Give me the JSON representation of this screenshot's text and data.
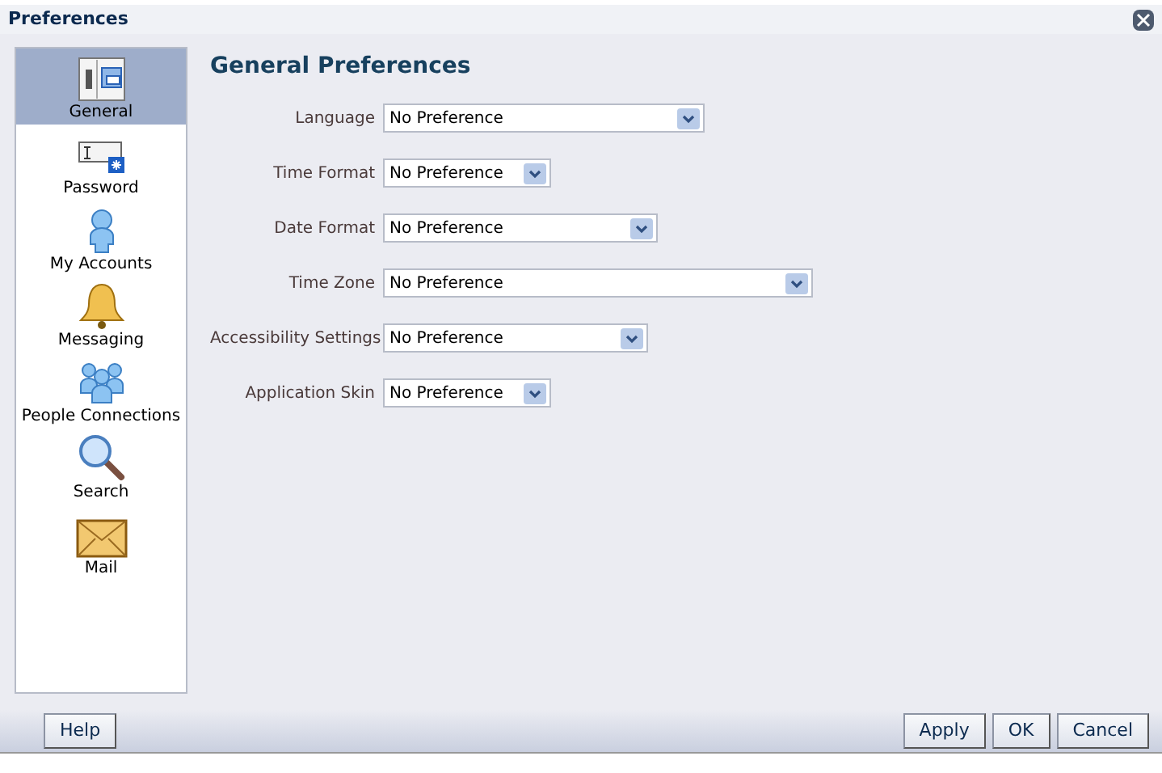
{
  "window": {
    "title": "Preferences"
  },
  "sidebar": {
    "items": [
      {
        "label": "General",
        "selected": true
      },
      {
        "label": "Password",
        "selected": false
      },
      {
        "label": "My Accounts",
        "selected": false
      },
      {
        "label": "Messaging",
        "selected": false
      },
      {
        "label": "People Connections",
        "selected": false
      },
      {
        "label": "Search",
        "selected": false
      },
      {
        "label": "Mail",
        "selected": false
      }
    ]
  },
  "heading": "General Preferences",
  "fields": [
    {
      "label": "Language",
      "value": "No Preference"
    },
    {
      "label": "Time Format",
      "value": "No Preference"
    },
    {
      "label": "Date Format",
      "value": "No Preference"
    },
    {
      "label": "Time Zone",
      "value": "No Preference"
    },
    {
      "label": "Accessibility Settings",
      "value": "No Preference"
    },
    {
      "label": "Application Skin",
      "value": "No Preference"
    }
  ],
  "buttons_left": [
    "Help"
  ],
  "buttons_right": [
    "Apply",
    "OK",
    "Cancel"
  ]
}
